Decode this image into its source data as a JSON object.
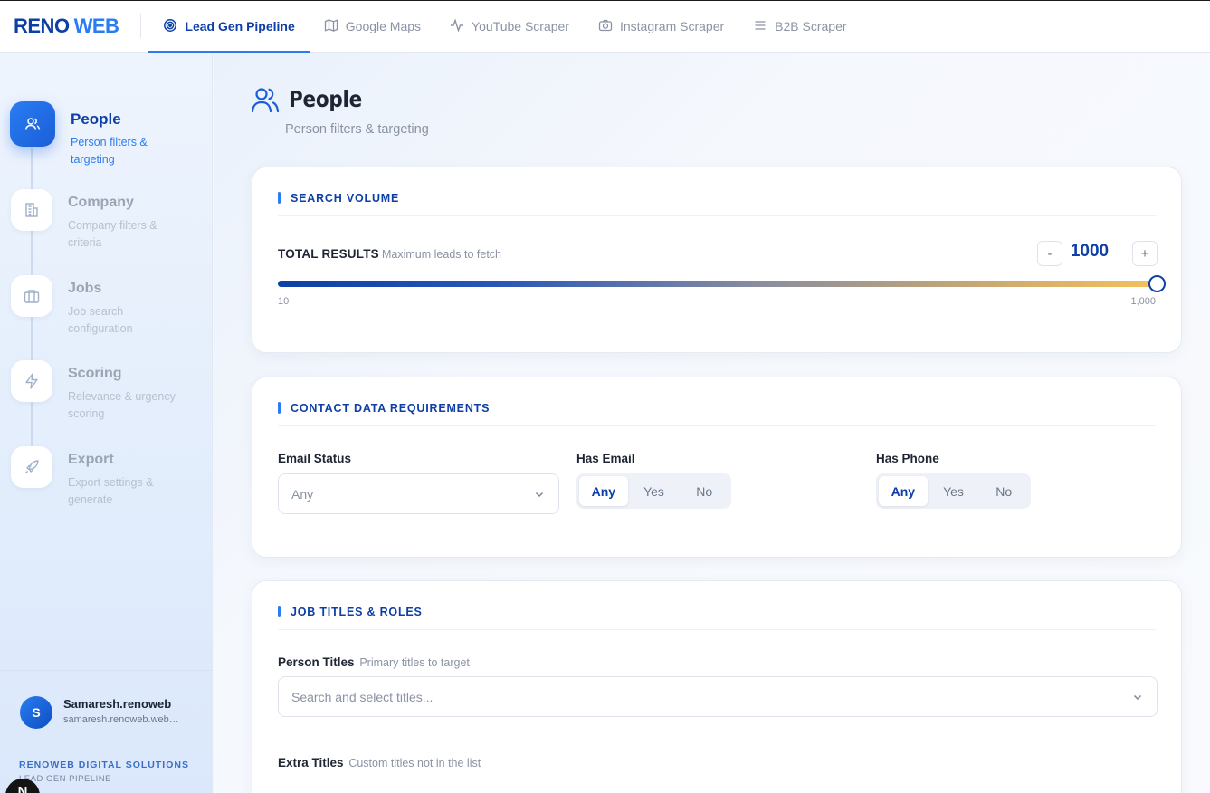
{
  "brand": {
    "part1": "RENO",
    "part2": "WEB"
  },
  "tabs": [
    {
      "label": "Lead Gen Pipeline",
      "icon": "target-icon"
    },
    {
      "label": "Google Maps",
      "icon": "map-icon"
    },
    {
      "label": "YouTube Scraper",
      "icon": "activity-icon"
    },
    {
      "label": "Instagram Scraper",
      "icon": "camera-icon"
    },
    {
      "label": "B2B Scraper",
      "icon": "list-icon"
    }
  ],
  "steps": [
    {
      "title": "People",
      "desc": "Person filters & targeting",
      "icon": "users-icon"
    },
    {
      "title": "Company",
      "desc": "Company filters & criteria",
      "icon": "building-icon"
    },
    {
      "title": "Jobs",
      "desc": "Job search configuration",
      "icon": "briefcase-icon"
    },
    {
      "title": "Scoring",
      "desc": "Relevance & urgency scoring",
      "icon": "zap-icon"
    },
    {
      "title": "Export",
      "desc": "Export settings & generate",
      "icon": "rocket-icon"
    }
  ],
  "user": {
    "initial": "S",
    "name": "Samaresh.renoweb",
    "email": "samaresh.renoweb.web@gmail.com"
  },
  "org": {
    "name": "RENOWEB DIGITAL SOLUTIONS",
    "sub": "LEAD GEN PIPELINE"
  },
  "n_badge": "N",
  "page": {
    "title": "People",
    "subtitle": "Person filters & targeting"
  },
  "search_volume": {
    "section_title": "SEARCH VOLUME",
    "label": "TOTAL RESULTS",
    "hint": "Maximum leads to fetch",
    "decrement": "-",
    "increment": "+",
    "value": "1000",
    "min_label": "10",
    "max_label": "1,000",
    "slider_fraction": 1.0
  },
  "contact": {
    "section_title": "CONTACT DATA REQUIREMENTS",
    "email_status": {
      "label": "Email Status",
      "value": "Any"
    },
    "has_email": {
      "label": "Has Email",
      "options": [
        "Any",
        "Yes",
        "No"
      ],
      "selected": "Any"
    },
    "has_phone": {
      "label": "Has Phone",
      "options": [
        "Any",
        "Yes",
        "No"
      ],
      "selected": "Any"
    }
  },
  "job_titles": {
    "section_title": "JOB TITLES & ROLES",
    "person_titles": {
      "label": "Person Titles",
      "hint": "Primary titles to target",
      "placeholder": "Search and select titles..."
    },
    "extra_titles": {
      "label": "Extra Titles",
      "hint": "Custom titles not in the list"
    }
  },
  "colors": {
    "accent": "#2a7cf2",
    "brand_dark": "#0d3fa6"
  }
}
